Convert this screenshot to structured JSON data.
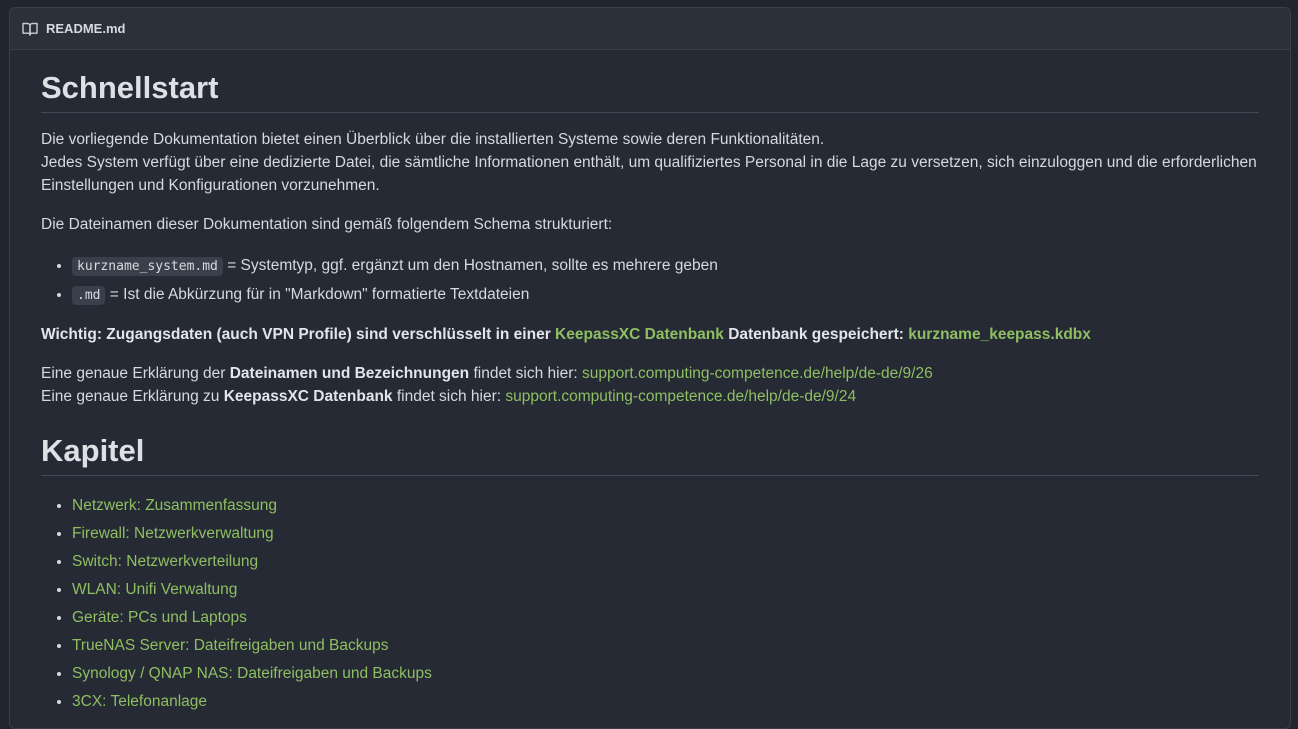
{
  "file": {
    "icon": "book-icon",
    "name": "README.md"
  },
  "quickstart": {
    "heading": "Schnellstart",
    "intro_line1": "Die vorliegende Dokumentation bietet einen Überblick über die installierten Systeme sowie deren Funktionalitäten.",
    "intro_line2": "Jedes System verfügt über eine dedizierte Datei, die sämtliche Informationen enthält, um qualifiziertes Personal in die Lage zu versetzen, sich einzuloggen und die erforderlichen Einstellungen und Konfigurationen vorzunehmen.",
    "schema_text": "Die Dateinamen dieser Dokumentation sind gemäß folgendem Schema strukturiert:",
    "file_items": [
      {
        "code": "kurzname_system.md",
        "text": " = Systemtyp, ggf. ergänzt um den Hostnamen, sollte es mehrere geben"
      },
      {
        "code": ".md",
        "text": " = Ist die Abkürzung für in \"Markdown\" formatierte Textdateien"
      }
    ],
    "important": {
      "prefix": "Wichtig: Zugangsdaten (auch VPN Profile) sind verschlüsselt in einer ",
      "link": "KeepassXC Datenbank",
      "middle": " Datenbank gespeichert: ",
      "file_link": "kurzname_keepass.kdbx"
    },
    "expl1": {
      "prefix": "Eine genaue Erklärung der ",
      "bold": "Dateinamen und Bezeichnungen",
      "middle": " findet sich hier: ",
      "link": "support.computing-competence.de/help/de-de/9/26"
    },
    "expl2": {
      "prefix": "Eine genaue Erklärung zu ",
      "bold": "KeepassXC Datenbank",
      "middle": " findet sich hier: ",
      "link": "support.computing-competence.de/help/de-de/9/24"
    }
  },
  "chapters": {
    "heading": "Kapitel",
    "items": [
      "Netzwerk: Zusammenfassung",
      "Firewall: Netzwerkverwaltung",
      "Switch: Netzwerkverteilung",
      "WLAN: Unifi Verwaltung",
      "Geräte: PCs und Laptops",
      "TrueNAS Server: Dateifreigaben und Backups",
      "Synology / QNAP NAS: Dateifreigaben und Backups",
      "3CX: Telefonanlage"
    ]
  },
  "colors": {
    "background": "#21252e",
    "link": "#8fbf62",
    "text": "#d6d9de"
  }
}
